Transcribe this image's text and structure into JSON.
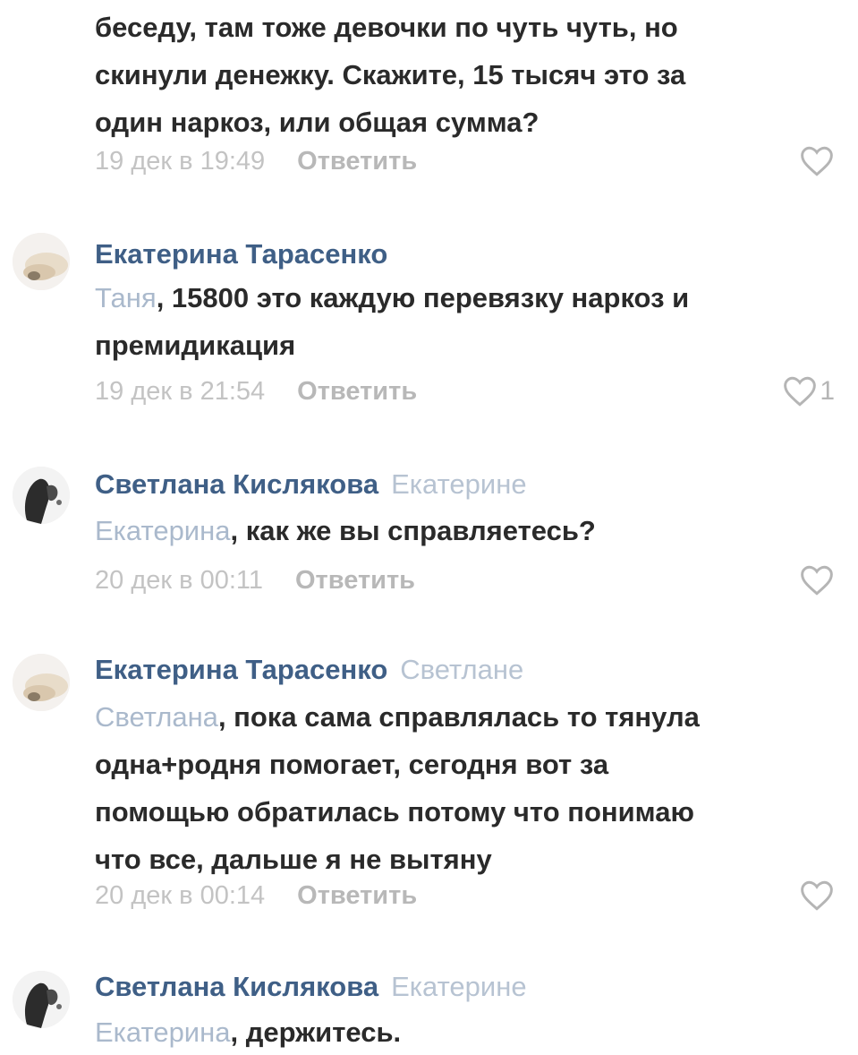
{
  "comments": [
    {
      "text_lines": [
        "беседу, там тоже девочки по чуть чуть, но",
        "скинули денежку. Скажите, 15 тысяч это за",
        "один наркоз, или общая сумма?"
      ],
      "date": "19 дек в 19:49",
      "reply_label": "Ответить"
    },
    {
      "author": "Екатерина Тарасенко",
      "addressee": "Таня",
      "text_first": ", 15800 это каждую перевязку наркоз и",
      "text_rest": "премидикация",
      "date": "19 дек в 21:54",
      "reply_label": "Ответить",
      "like_count": "1"
    },
    {
      "author": "Светлана Кислякова",
      "reply_to": "Екатерине",
      "addressee": "Екатерина",
      "text_first": ", как же вы справляетесь?",
      "date": "20 дек в 00:11",
      "reply_label": "Ответить"
    },
    {
      "author": "Екатерина Тарасенко",
      "reply_to": "Светлане",
      "addressee": "Светлана",
      "text_first": ", пока сама справлялась то тянула",
      "text_rest": [
        "одна+родня помогает, сегодня вот за",
        "помощью обратилась потому что понимаю",
        "что все, дальше я не вытяну"
      ],
      "date": "20 дек в 00:14",
      "reply_label": "Ответить"
    },
    {
      "author": "Светлана Кислякова",
      "reply_to": "Екатерине",
      "addressee": "Екатерина",
      "text_first": ", держитесь."
    }
  ],
  "colors": {
    "author": "#3f5f86",
    "addressee": "#aab9cc",
    "text": "#2a2a2a",
    "meta": "#c3c3c3"
  },
  "icons": {
    "like": "heart-outline-icon"
  }
}
